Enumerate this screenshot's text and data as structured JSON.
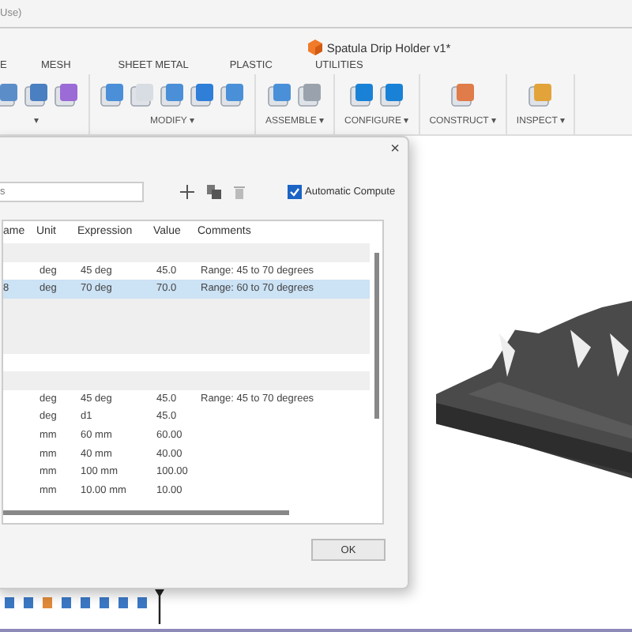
{
  "top_bar": {
    "text": "Use)"
  },
  "window": {
    "title": "Spatula Drip Holder v1*"
  },
  "tabs": [
    {
      "label": "E",
      "selected": false
    },
    {
      "label": "MESH",
      "selected": false
    },
    {
      "label": "SHEET METAL",
      "selected": false
    },
    {
      "label": "PLASTIC",
      "selected": false
    },
    {
      "label": "UTILITIES",
      "selected": false
    }
  ],
  "groups": [
    {
      "label": "▾",
      "icons": [
        {
          "kind": "box"
        },
        {
          "kind": "nodes"
        },
        {
          "kind": "mesh"
        }
      ]
    },
    {
      "label": "MODIFY ▾",
      "icons": [
        {
          "kind": "press"
        },
        {
          "kind": "fillet"
        },
        {
          "kind": "shell"
        },
        {
          "kind": "combine"
        },
        {
          "kind": "split"
        }
      ]
    },
    {
      "label": "ASSEMBLE ▾",
      "icons": [
        {
          "kind": "component"
        },
        {
          "kind": "joint"
        }
      ]
    },
    {
      "label": "CONFIGURE ▾",
      "icons": [
        {
          "kind": "config"
        },
        {
          "kind": "table"
        }
      ]
    },
    {
      "label": "CONSTRUCT ▾",
      "icons": [
        {
          "kind": "plane"
        }
      ]
    },
    {
      "label": "INSPECT ▾",
      "icons": [
        {
          "kind": "measure"
        }
      ]
    }
  ],
  "dialog": {
    "close": "×",
    "search": {
      "value": "s"
    },
    "auto_compute": {
      "label": "Automatic Compute",
      "checked": true
    },
    "columns": [
      "ame",
      "Unit",
      "Expression",
      "Value",
      "Comments"
    ],
    "rows": [
      {
        "kind": "group"
      },
      {
        "kind": "param",
        "selected": false,
        "cells": [
          "deg",
          "45 deg",
          "45.0",
          "Range: 45 to 70 degrees"
        ]
      },
      {
        "kind": "param",
        "selected": true,
        "name": "8",
        "cells": [
          "deg",
          "70 deg",
          "70.0",
          "Range: 60 to 70 degrees"
        ]
      },
      {
        "kind": "group"
      },
      {
        "kind": "group"
      },
      {
        "kind": "group"
      },
      {
        "kind": "blank"
      },
      {
        "kind": "group"
      },
      {
        "kind": "param",
        "selected": false,
        "cells": [
          "deg",
          "45 deg",
          "45.0",
          "Range: 45 to 70 degrees"
        ]
      },
      {
        "kind": "param",
        "selected": false,
        "cells": [
          "deg",
          "d1",
          "45.0"
        ]
      },
      {
        "kind": "param",
        "selected": false,
        "cells": [
          "mm",
          "60 mm",
          "60.00"
        ]
      },
      {
        "kind": "param",
        "selected": false,
        "cells": [
          "mm",
          "40 mm",
          "40.00"
        ]
      },
      {
        "kind": "param",
        "selected": false,
        "cells": [
          "mm",
          "100 mm",
          "100.00"
        ]
      },
      {
        "kind": "param",
        "selected": false,
        "cells": [
          "mm",
          "10.00 mm",
          "10.00"
        ]
      },
      {
        "kind": "blank"
      }
    ],
    "ok": "OK"
  }
}
